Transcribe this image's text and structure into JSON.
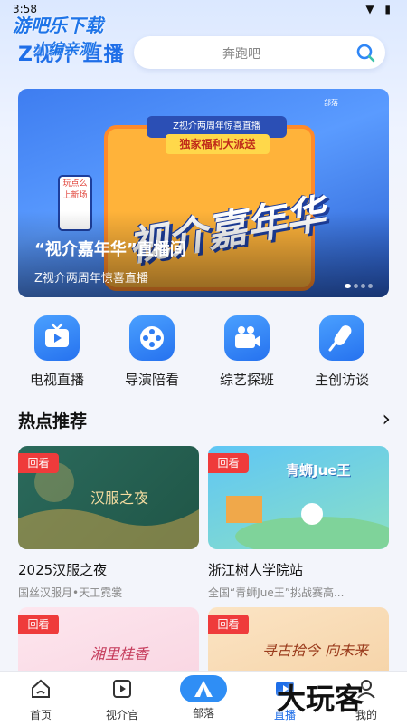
{
  "status_bar": {
    "time": "3:58",
    "icons": "▼ ▮"
  },
  "watermark": {
    "line1": "游吧乐下载",
    "line2": "小编亲测",
    "bottom": "大玩客"
  },
  "header": {
    "logo": "Z视介 直播",
    "search_placeholder": "奔跑吧"
  },
  "banner": {
    "header_text": "Z视介两周年惊喜直播",
    "header_sub": "独家福利大派送",
    "big_text": "视介嘉年华",
    "phone_text": "玩点么上新场",
    "brand_text": "部落",
    "title": "“视介嘉年华”直播间",
    "subtitle": "Z视介两周年惊喜直播",
    "dots": 4,
    "active_dot": 0
  },
  "categories": [
    {
      "label": "电视直播",
      "icon": "tv-icon"
    },
    {
      "label": "导演陪看",
      "icon": "film-reel-icon"
    },
    {
      "label": "综艺探班",
      "icon": "video-camera-icon"
    },
    {
      "label": "主创访谈",
      "icon": "microphone-icon"
    }
  ],
  "section": {
    "title": "热点推荐",
    "more": "›"
  },
  "cards": [
    {
      "badge": "回看",
      "title": "2025汉服之夜",
      "subtitle": "国丝汉服月•天工霓裳",
      "image_text": "汉服之夜"
    },
    {
      "badge": "回看",
      "title": "浙江树人学院站",
      "subtitle": "全国“青蛳Jue王”挑战赛高...",
      "image_text": "青蛳Jue王"
    },
    {
      "badge": "回看",
      "title": "",
      "subtitle": "",
      "image_text": "湘里桂香"
    },
    {
      "badge": "回看",
      "title": "",
      "subtitle": "",
      "image_text": "寻古拾今 向未来"
    }
  ],
  "tabs": [
    {
      "label": "首页",
      "icon": "home-icon",
      "active": false
    },
    {
      "label": "视介官",
      "icon": "play-square-icon",
      "active": false
    },
    {
      "label": "部落",
      "icon": "tent-icon",
      "active": false
    },
    {
      "label": "直播",
      "icon": "live-icon",
      "active": true
    },
    {
      "label": "我的",
      "icon": "user-icon",
      "active": false
    }
  ]
}
